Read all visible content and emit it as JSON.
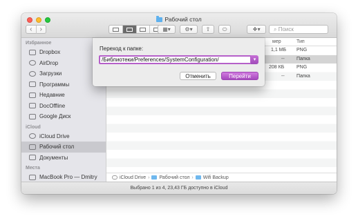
{
  "window": {
    "title": "Рабочий стол",
    "search_placeholder": "Поиск"
  },
  "sidebar": {
    "sections": [
      {
        "title": "Избранное",
        "items": [
          "Dropbox",
          "AirDrop",
          "Загрузки",
          "Программы",
          "Недавние",
          "DocOffline",
          "Google Диск"
        ]
      },
      {
        "title": "iCloud",
        "items": [
          "iCloud Drive",
          "Рабочий стол",
          "Документы"
        ]
      },
      {
        "title": "Места",
        "items": [
          "MacBook Pro — Dmitry"
        ]
      }
    ],
    "active_item": "Рабочий стол"
  },
  "columns": {
    "size": "мер",
    "kind": "Тип"
  },
  "rows": [
    {
      "size": "1,1 МБ",
      "kind": "PNG"
    },
    {
      "size": "--",
      "kind": "Папка"
    },
    {
      "size": "208 КБ",
      "kind": "PNG"
    },
    {
      "size": "--",
      "kind": "Папка"
    }
  ],
  "pathbar": [
    "iCloud Drive",
    "Рабочий стол",
    "Wifi Backup"
  ],
  "status": "Выбрано 1 из 4, 23,43 ГБ доступно в iCloud",
  "dialog": {
    "label": "Переход к папке:",
    "path_value": "/Библиотеки/Preferences/SystemConfiguration/",
    "cancel_label": "Отменить",
    "go_label": "Перейти"
  },
  "colors": {
    "accent": "#b55fc9",
    "folder": "#5fb1ee",
    "selection": "#d4d4d4"
  },
  "icons": [
    "back-icon",
    "forward-icon",
    "list-view-icon",
    "gear-icon",
    "share-icon",
    "tag-icon",
    "dropbox-icon",
    "search-icon"
  ]
}
